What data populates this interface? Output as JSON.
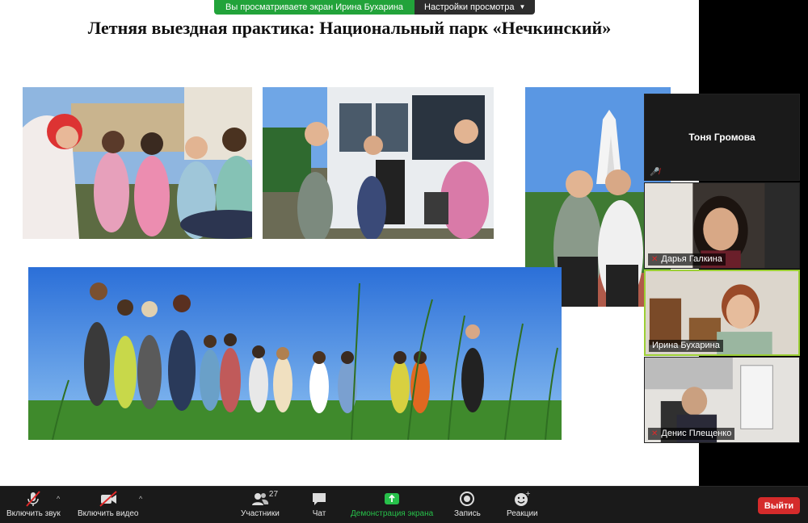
{
  "share_banner": {
    "viewing_text": "Вы просматриваете экран Ирина Бухарина",
    "view_options": "Настройки просмотра"
  },
  "slide": {
    "title": "Летняя выездная практика: Национальный парк «Нечкинский»"
  },
  "participants": [
    {
      "name": "Тоня Громова",
      "muted": true,
      "video": false
    },
    {
      "name": "Дарья Галкина",
      "muted": true,
      "video": true
    },
    {
      "name": "Ирина Бухарина",
      "muted": false,
      "video": true,
      "active_speaker": true
    },
    {
      "name": "Денис Плещенко",
      "muted": true,
      "video": true
    }
  ],
  "toolbar": {
    "unmute_label": "Включить звук",
    "start_video_label": "Включить видео",
    "participants_label": "Участники",
    "participants_count": "27",
    "chat_label": "Чат",
    "share_screen_label": "Демонстрация экрана",
    "record_label": "Запись",
    "reactions_label": "Реакции",
    "leave_label": "Выйти"
  },
  "colors": {
    "accent_green": "#27c04a",
    "leave_red": "#d52b2b",
    "active_border": "#9ccf34"
  }
}
